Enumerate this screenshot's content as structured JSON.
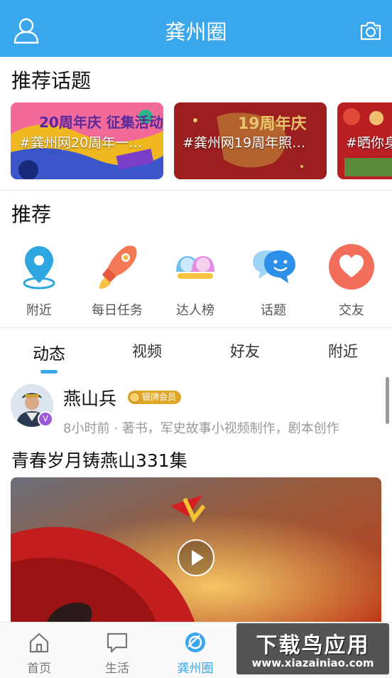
{
  "header": {
    "title": "龚州圈",
    "left_icon": "user-icon",
    "right_icon": "camera-icon"
  },
  "recommended_topics": {
    "title": "推荐话题",
    "cards": [
      {
        "label": "#龚州网20周年一一#…",
        "image_text": "20周年庆 征集活动"
      },
      {
        "label": "#龚州网19周年照片…",
        "image_text": "19周年庆"
      },
      {
        "label": "#晒你身"
      }
    ]
  },
  "recommend": {
    "title": "推荐",
    "items": [
      {
        "label": "附近",
        "icon": "location-pin-icon"
      },
      {
        "label": "每日任务",
        "icon": "rocket-icon"
      },
      {
        "label": "达人榜",
        "icon": "people-icon"
      },
      {
        "label": "话题",
        "icon": "chat-bubbles-icon"
      },
      {
        "label": "交友",
        "icon": "heart-icon"
      }
    ]
  },
  "feed_tabs": {
    "items": [
      "动态",
      "视频",
      "好友",
      "附近"
    ],
    "active": "动态"
  },
  "post": {
    "username": "燕山兵",
    "badge": "银牌会员",
    "meta": "8小时前 · 著书，军史故事小视频制作，剧本创作",
    "title": "青春岁月铸燕山331集",
    "verified_icon": "v-badge-icon"
  },
  "bottom_nav": {
    "items": [
      {
        "label": "首页",
        "icon": "home-icon",
        "active": false
      },
      {
        "label": "生活",
        "icon": "chat-icon",
        "active": false
      },
      {
        "label": "龚州圈",
        "icon": "circle-icon",
        "active": true
      }
    ]
  },
  "watermark": {
    "main": "下载鸟应用",
    "sub": "www.xiazainiao.com"
  },
  "colors": {
    "accent": "#3aa6ec",
    "header_bg": "#3aa6ec",
    "badge_gold": "#e0a628"
  }
}
